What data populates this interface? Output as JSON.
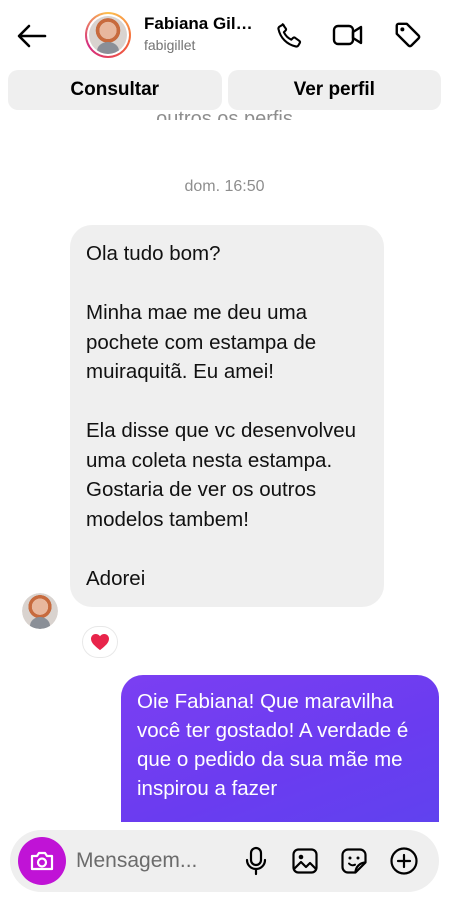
{
  "header": {
    "name": "Fabiana Gillet",
    "username": "fabigillet",
    "back_icon": "arrow-left-icon",
    "icons": [
      "phone-icon",
      "video-camera-icon",
      "tag-icon"
    ]
  },
  "actions": {
    "consult_label": "Consultar",
    "profile_label": "Ver perfil"
  },
  "peek_text": "outros os perfis",
  "conversation": {
    "timestamp": "dom. 16:50",
    "incoming": {
      "lines": [
        "Ola tudo bom?",
        "Minha mae me deu uma pochete com estampa de muiraquitã. Eu amei!",
        "Ela disse que vc desenvolveu uma coleta nesta estampa. Gostaria de ver os outros modelos tambem!",
        "Adorei"
      ],
      "reaction": "❤️"
    },
    "outgoing": {
      "text": "Oie Fabiana! Que maravilha você ter gostado! A verdade é que o pedido da sua mãe me inspirou a fazer"
    }
  },
  "composer": {
    "placeholder": "Mensagem...",
    "accent": "#c013d6",
    "icons": [
      "camera-icon",
      "microphone-icon",
      "image-icon",
      "sticker-icon",
      "plus-circle-icon"
    ]
  },
  "colors": {
    "incoming_bubble": "#efefef",
    "outgoing_bubble": "#6a3cf0",
    "secondary_text": "#8e8e8e"
  }
}
